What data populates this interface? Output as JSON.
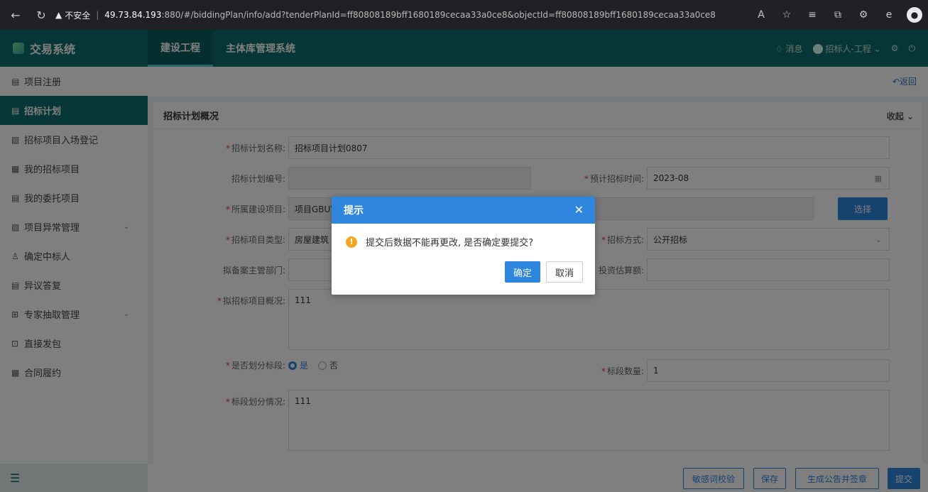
{
  "browser": {
    "insecure_label": "不安全",
    "url_host": "49.73.84.193",
    "url_rest": ":880/#/biddingPlan/info/add?tenderPlanId=ff80808189bff1680189cecaa33a0ce8&objectId=ff80808189bff1680189cecaa33a0ce8"
  },
  "app": {
    "title": "交易系统",
    "nav": [
      {
        "label": "建设工程",
        "active": true
      },
      {
        "label": "主体库管理系统",
        "active": false
      }
    ],
    "messages_label": "消息",
    "user_label": "招标人-工程"
  },
  "sidebar": {
    "items": [
      {
        "label": "项目注册",
        "icon": "document-icon",
        "active": false,
        "has_children": false
      },
      {
        "label": "招标计划",
        "icon": "document-icon",
        "active": true,
        "has_children": false
      },
      {
        "label": "招标项目入场登记",
        "icon": "edit-doc-icon",
        "active": false,
        "has_children": false
      },
      {
        "label": "我的招标项目",
        "icon": "folder-icon",
        "active": false,
        "has_children": false
      },
      {
        "label": "我的委托项目",
        "icon": "document-icon",
        "active": false,
        "has_children": false
      },
      {
        "label": "项目异常管理",
        "icon": "alert-doc-icon",
        "active": false,
        "has_children": true
      },
      {
        "label": "确定中标人",
        "icon": "user-icon",
        "active": false,
        "has_children": false
      },
      {
        "label": "异议答复",
        "icon": "document-icon",
        "active": false,
        "has_children": false
      },
      {
        "label": "专家抽取管理",
        "icon": "expert-icon",
        "active": false,
        "has_children": true
      },
      {
        "label": "直接发包",
        "icon": "package-icon",
        "active": false,
        "has_children": false
      },
      {
        "label": "合同履约",
        "icon": "contract-icon",
        "active": false,
        "has_children": false
      }
    ]
  },
  "content": {
    "back_label": "返回",
    "card_title": "招标计划概况",
    "collapse_label": "收起",
    "fields": {
      "plan_name_label": "招标计划名称:",
      "plan_name_value": "招标项目计划0807",
      "plan_no_label": "招标计划编号:",
      "plan_no_value": "",
      "plan_time_label": "预计招标时间:",
      "plan_time_value": "2023-08",
      "project_label": "所属建设项目:",
      "project_value": "项目GBUY",
      "select_button": "选择",
      "type_label": "招标项目类型:",
      "type_value": "房屋建筑",
      "method_label": "招标方式:",
      "method_value": "公开招标",
      "dept_label": "拟备案主管部门:",
      "dept_value": "",
      "invest_label": "投资估算额:",
      "invest_value": "",
      "overview_label": "拟招标项目概况:",
      "overview_value": "111",
      "split_label": "是否划分标段:",
      "split_yes": "是",
      "split_no": "否",
      "count_label": "标段数量:",
      "count_value": "1",
      "split_desc_label": "标段划分情况:",
      "split_desc_value": "111"
    },
    "buttons": {
      "sensitive": "敏感词校验",
      "save": "保存",
      "generate": "生成公告并签章",
      "submit": "提交"
    }
  },
  "dialog": {
    "title": "提示",
    "message": "提交后数据不能再更改, 是否确定要提交?",
    "ok": "确定",
    "cancel": "取消"
  }
}
